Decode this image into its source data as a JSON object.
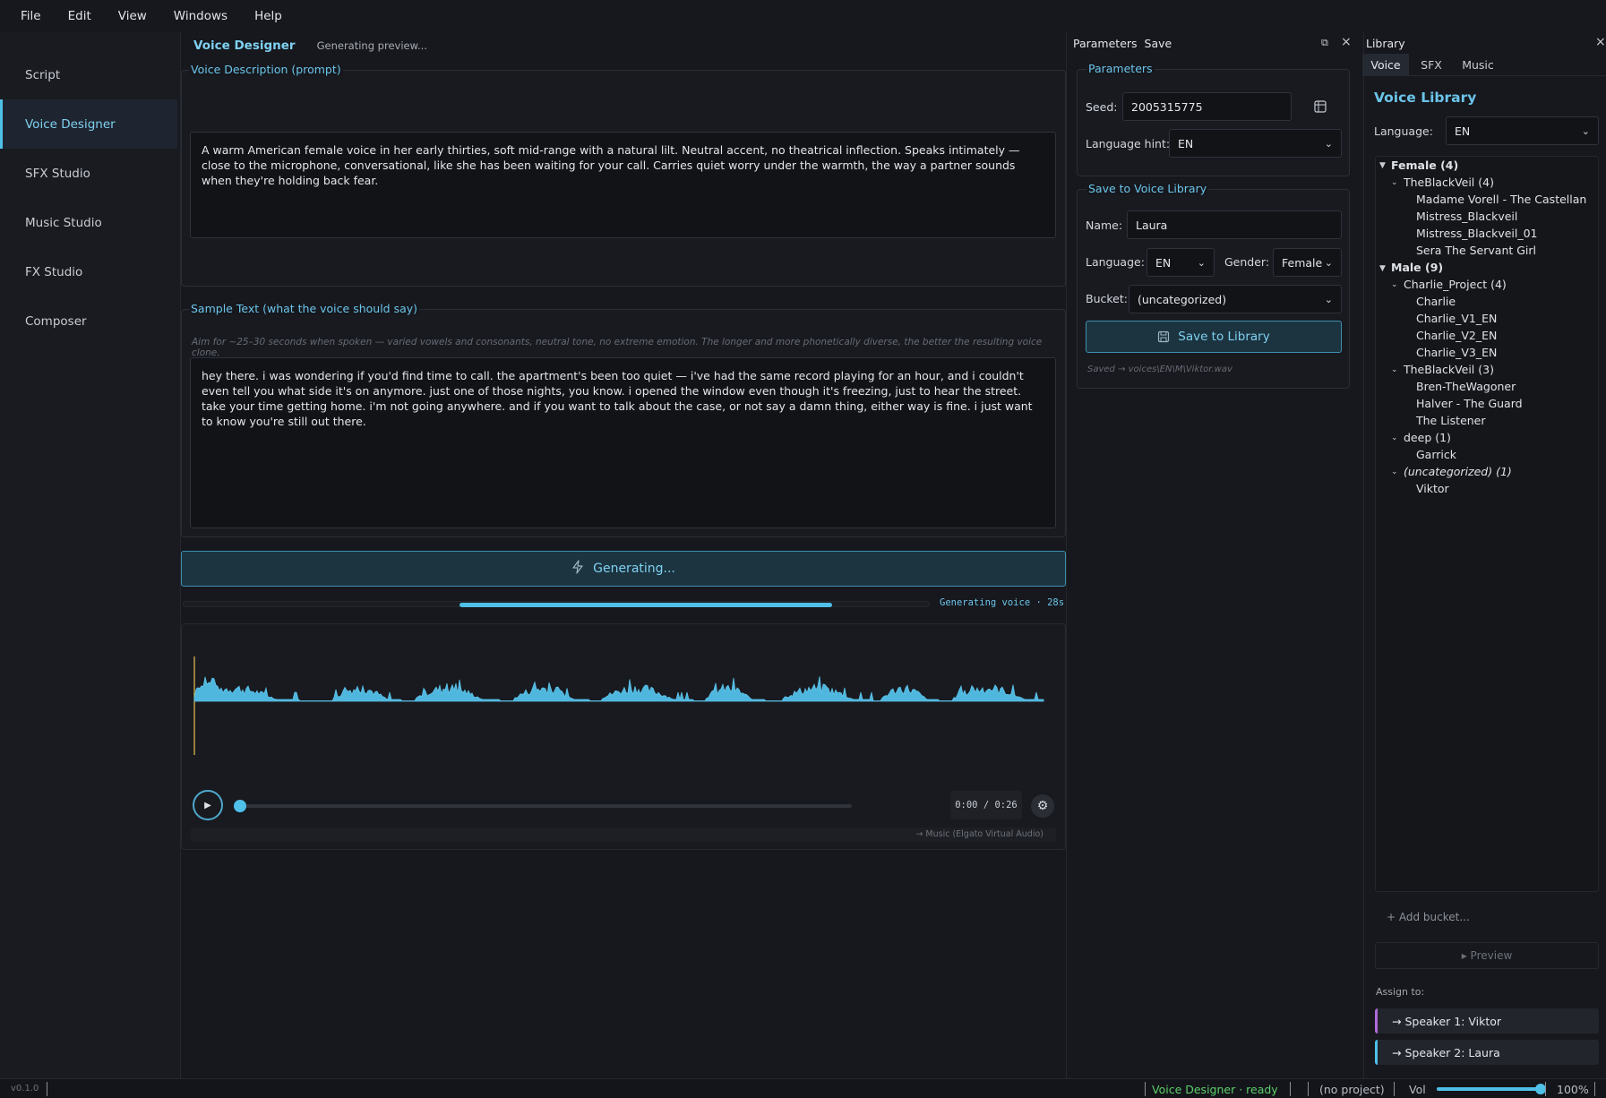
{
  "menubar": {
    "items": [
      "File",
      "Edit",
      "View",
      "Windows",
      "Help"
    ]
  },
  "sidebar": {
    "items": [
      {
        "label": "Script"
      },
      {
        "label": "Voice Designer",
        "active": true
      },
      {
        "label": "SFX Studio"
      },
      {
        "label": "Music Studio"
      },
      {
        "label": "FX Studio"
      },
      {
        "label": "Composer"
      }
    ]
  },
  "voice_designer": {
    "title": "Voice Designer",
    "status": "Generating preview...",
    "prompt_group": "Voice Description (prompt)",
    "prompt_text": "A warm American female voice in her early thirties, soft mid-range with a natural lilt. Neutral accent, no theatrical inflection. Speaks intimately — close to the microphone, conversational, like she has been waiting for your call. Carries quiet worry under the warmth, the way a partner sounds when they're holding back fear.",
    "sample_group": "Sample Text  (what the voice should say)",
    "sample_hint": "Aim for ~25–30 seconds when spoken — varied vowels and consonants, neutral tone, no extreme emotion. The longer and more phonetically diverse, the better the resulting voice clone.",
    "sample_text": "hey there. i was wondering if you'd find time to call. the apartment's been too quiet — i've had the same record playing for an hour, and i couldn't even tell you what side it's on anymore. just one of those nights, you know. i opened the window even though it's freezing, just to hear the street. take your time getting home. i'm not going anywhere. and if you want to talk about the case, or not say a damn thing, either way is fine. i just want to know you're still out there.",
    "generate_label": "Generating...",
    "progress_label": "Generating voice · 28s",
    "progress_start": 0.37,
    "progress_end": 0.87,
    "player": {
      "time": "0:00 / 0:26",
      "output": "→ Music (Elgato Virtual Audio)",
      "position": 0.0
    }
  },
  "params_dock": {
    "tabs": [
      "Parameters",
      "Save"
    ],
    "params_group": "Parameters",
    "seed_label": "Seed:",
    "seed_value": "2005315775",
    "lang_hint_label": "Language hint:",
    "lang_hint_value": "EN",
    "save_group": "Save to Voice Library",
    "name_label": "Name:",
    "name_value": "Laura",
    "language_label": "Language:",
    "language_value": "EN",
    "gender_label": "Gender:",
    "gender_value": "Female",
    "bucket_label": "Bucket:",
    "bucket_value": "(uncategorized)",
    "save_button": "Save to Library",
    "saved_path": "Saved → voices\\EN\\M\\Viktor.wav"
  },
  "library": {
    "dock_title": "Library",
    "tabs": [
      "Voice",
      "SFX",
      "Music"
    ],
    "heading": "Voice Library",
    "language_label": "Language:",
    "language_value": "EN",
    "tree": {
      "female": "Female  (4)",
      "f_blackveil": "TheBlackVeil  (4)",
      "f1": "Madame Vorell - The Castellan",
      "f2": "Mistress_Blackveil",
      "f3": "Mistress_Blackveil_01",
      "f4": "Sera  The Servant Girl",
      "male": "Male  (9)",
      "m_charlie": "Charlie_Project  (4)",
      "m1": "Charlie",
      "m2": "Charlie_V1_EN",
      "m3": "Charlie_V2_EN",
      "m4": "Charlie_V3_EN",
      "m_blackveil": "TheBlackVeil  (3)",
      "m5": "Bren-TheWagoner",
      "m6": "Halver - The Guard",
      "m7": "The Listener",
      "m_deep": "deep  (1)",
      "m8": "Garrick",
      "m_uncat": "(uncategorized)  (1)",
      "m9": "Viktor"
    },
    "add_bucket": "+  Add bucket...",
    "preview": "▸  Preview",
    "assign_label": "Assign to:",
    "assign1": "→  Speaker 1: Viktor",
    "assign2": "→  Speaker 2: Laura",
    "assign1_color": "#b06ad8",
    "assign2_color": "#4fc0e8"
  },
  "statusbar": {
    "version": "v0.1.0",
    "state": "Voice Designer · ready",
    "project": "(no project)",
    "vol_label": "Vol",
    "vol_pct": "100%",
    "volume": 1.0
  },
  "colors": {
    "accent": "#4fc0e8",
    "ready": "#5ecf6a",
    "background": "#16181d"
  }
}
